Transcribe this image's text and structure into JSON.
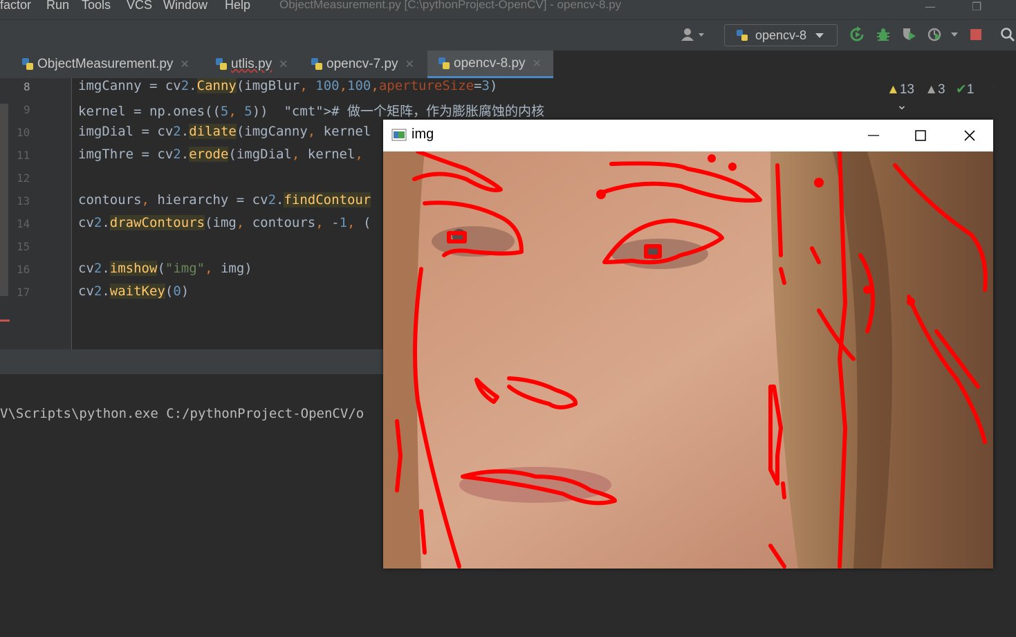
{
  "menu": {
    "items": [
      "factor",
      "Run",
      "Tools",
      "VCS",
      "Window",
      "Help"
    ],
    "title": "ObjectMeasurement.py [C:\\pythonProject-OpenCV] - opencv-8.py"
  },
  "toolbar": {
    "run_config": "opencv-8",
    "icons": [
      "user-icon",
      "python-icon",
      "rerun-icon",
      "debug-icon",
      "coverage-icon",
      "profile-icon",
      "stop-icon",
      "search-icon"
    ],
    "stop_color": "#c75450",
    "run_color": "#499c54"
  },
  "tabs": [
    {
      "label": "ObjectMeasurement.py",
      "active": false
    },
    {
      "label": "utlis.py",
      "active": false
    },
    {
      "label": "opencv-7.py",
      "active": false
    },
    {
      "label": "opencv-8.py",
      "active": true
    }
  ],
  "inspections": {
    "warnings": "13",
    "weak_warnings": "3",
    "ok": "1"
  },
  "editor": {
    "line_numbers": [
      "8",
      "9",
      "10",
      "11",
      "12",
      "13",
      "14",
      "15",
      "16",
      "17"
    ],
    "lines": [
      "imgCanny = cv2.Canny(imgBlur, 100,100,apertureSize=3)",
      "kernel = np.ones((5, 5))  # 做一个矩阵，作为膨胀腐蚀的内核",
      "imgDial = cv2.dilate(imgCanny, kernel",
      "imgThre = cv2.erode(imgDial, kernel,",
      "",
      "contours, hierarchy = cv2.findContour",
      "cv2.drawContours(img, contours, -1, (",
      "",
      "cv2.imshow(\"img\", img)",
      "cv2.waitKey(0)"
    ]
  },
  "console": {
    "line": "V\\Scripts\\python.exe C:/pythonProject-OpenCV/o"
  },
  "image_window": {
    "title": "img",
    "contour_color": "#ff0000"
  }
}
